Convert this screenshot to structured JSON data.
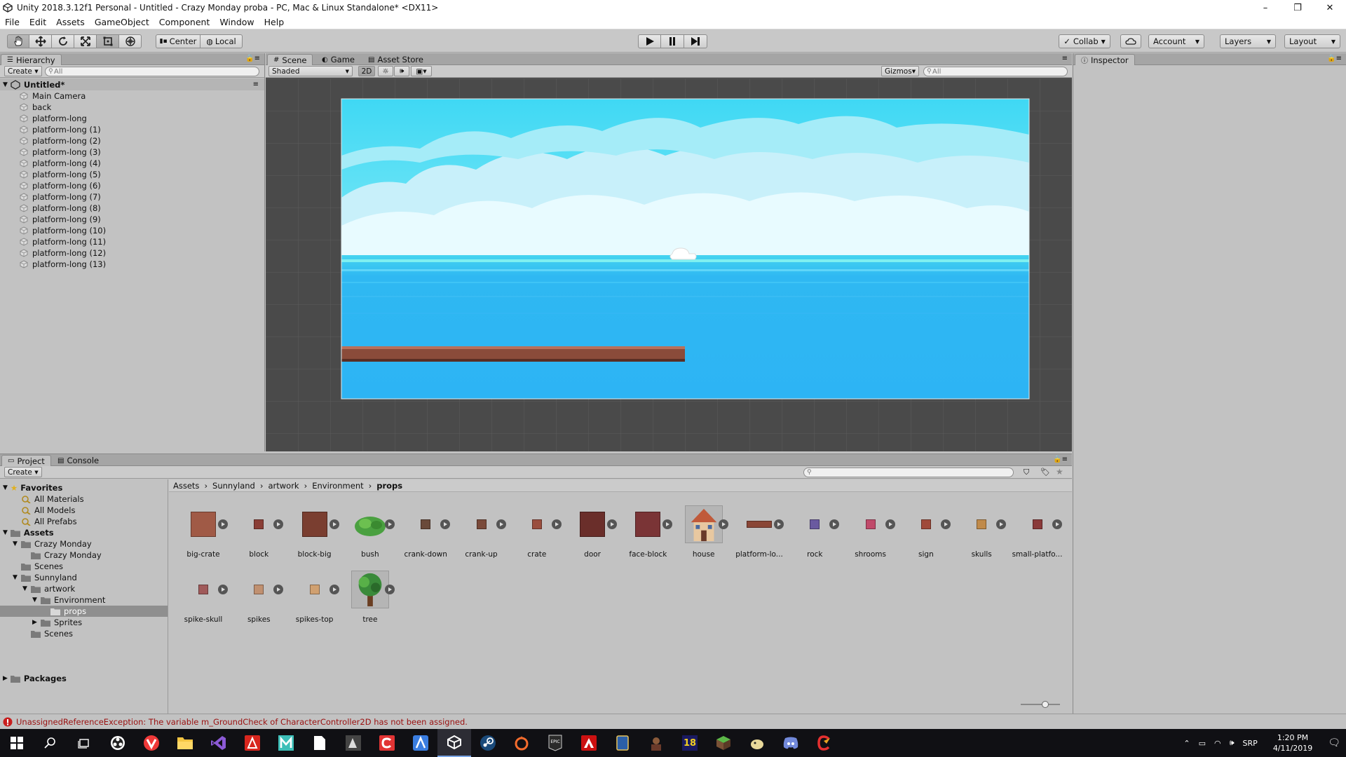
{
  "window": {
    "title": "Unity 2018.3.12f1 Personal - Untitled - Crazy Monday proba - PC, Mac & Linux Standalone* <DX11>",
    "controls": [
      "–",
      "❐",
      "✕"
    ]
  },
  "menu": [
    "File",
    "Edit",
    "Assets",
    "GameObject",
    "Component",
    "Window",
    "Help"
  ],
  "toolbar": {
    "pivot": "Center",
    "space": "Local",
    "collab": "Collab",
    "account": "Account",
    "layers": "Layers",
    "layout": "Layout"
  },
  "hierarchy": {
    "tab": "Hierarchy",
    "create": "Create",
    "search_placeholder": "All",
    "scene": "Untitled*",
    "items": [
      "Main Camera",
      "back",
      "platform-long",
      "platform-long (1)",
      "platform-long (2)",
      "platform-long (3)",
      "platform-long (4)",
      "platform-long (5)",
      "platform-long (6)",
      "platform-long (7)",
      "platform-long (8)",
      "platform-long (9)",
      "platform-long (10)",
      "platform-long (11)",
      "platform-long (12)",
      "platform-long (13)"
    ]
  },
  "scene_view": {
    "tabs": [
      "Scene",
      "Game",
      "Asset Store"
    ],
    "shading": "Shaded",
    "mode_2d": "2D",
    "gizmos": "Gizmos",
    "search_placeholder": "All"
  },
  "inspector": {
    "tab": "Inspector"
  },
  "project": {
    "tabs": [
      "Project",
      "Console"
    ],
    "create": "Create",
    "breadcrumb": [
      "Assets",
      "Sunnyland",
      "artwork",
      "Environment",
      "props"
    ],
    "favorites_label": "Favorites",
    "favorites": [
      "All Materials",
      "All Models",
      "All Prefabs"
    ],
    "assets_label": "Assets",
    "tree": [
      {
        "label": "Crazy Monday",
        "depth": 1,
        "expanded": true
      },
      {
        "label": "Crazy Monday",
        "depth": 2
      },
      {
        "label": "Scenes",
        "depth": 1
      },
      {
        "label": "Sunnyland",
        "depth": 1,
        "expanded": true
      },
      {
        "label": "artwork",
        "depth": 2,
        "expanded": true
      },
      {
        "label": "Environment",
        "depth": 3,
        "expanded": true
      },
      {
        "label": "props",
        "depth": 4,
        "selected": true
      },
      {
        "label": "Sprites",
        "depth": 3,
        "collapsed": true
      },
      {
        "label": "Scenes",
        "depth": 2
      }
    ],
    "packages_label": "Packages",
    "assets": [
      "big-crate",
      "block",
      "block-big",
      "bush",
      "crank-down",
      "crank-up",
      "crate",
      "door",
      "face-block",
      "house",
      "platform-lo...",
      "rock",
      "shrooms",
      "sign",
      "skulls",
      "small-platfo...",
      "spike-skull",
      "spikes",
      "spikes-top",
      "tree"
    ]
  },
  "status": {
    "message": "UnassignedReferenceException: The variable m_GroundCheck of CharacterController2D has not been assigned."
  },
  "taskbar": {
    "time": "1:20 PM",
    "date": "4/11/2019",
    "language": "SRP",
    "badge": "18"
  },
  "colors": {
    "sky": "#49d8f0",
    "sea": "#28b4f4",
    "platform": "#8a4b3a",
    "error": "#c81e1e"
  }
}
